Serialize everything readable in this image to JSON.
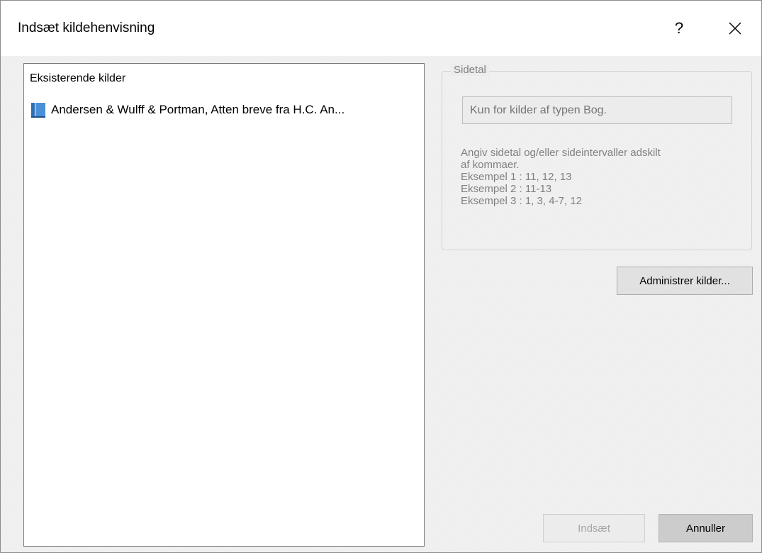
{
  "window": {
    "title": "Indsæt kildehenvisning",
    "help_label": "?",
    "close_icon": "close-icon"
  },
  "sources": {
    "header": "Eksisterende kilder",
    "items": [
      {
        "label": "Andersen & Wulff & Portman, Atten breve fra H.C. An...",
        "icon": "book-icon",
        "icon_color": "#2f6fb5"
      }
    ]
  },
  "page_group": {
    "legend": "Sidetal",
    "input_placeholder": "Kun for kilder af typen Bog.",
    "input_value": "",
    "help_lines": [
      "Angiv sidetal og/eller sideintervaller adskilt",
      "af kommaer.",
      "Eksempel 1 : 11, 12, 13",
      "Eksempel 2 : 11-13",
      "Eksempel 3 : 1, 3, 4-7, 12"
    ]
  },
  "buttons": {
    "manage": "Administrer kilder...",
    "insert": "Indsæt",
    "cancel": "Annuller"
  },
  "colors": {
    "dialog_background": "#ececec",
    "list_background": "#ffffff",
    "disabled_text": "#a6a6a6",
    "book_icon": "#2f6fb5"
  }
}
